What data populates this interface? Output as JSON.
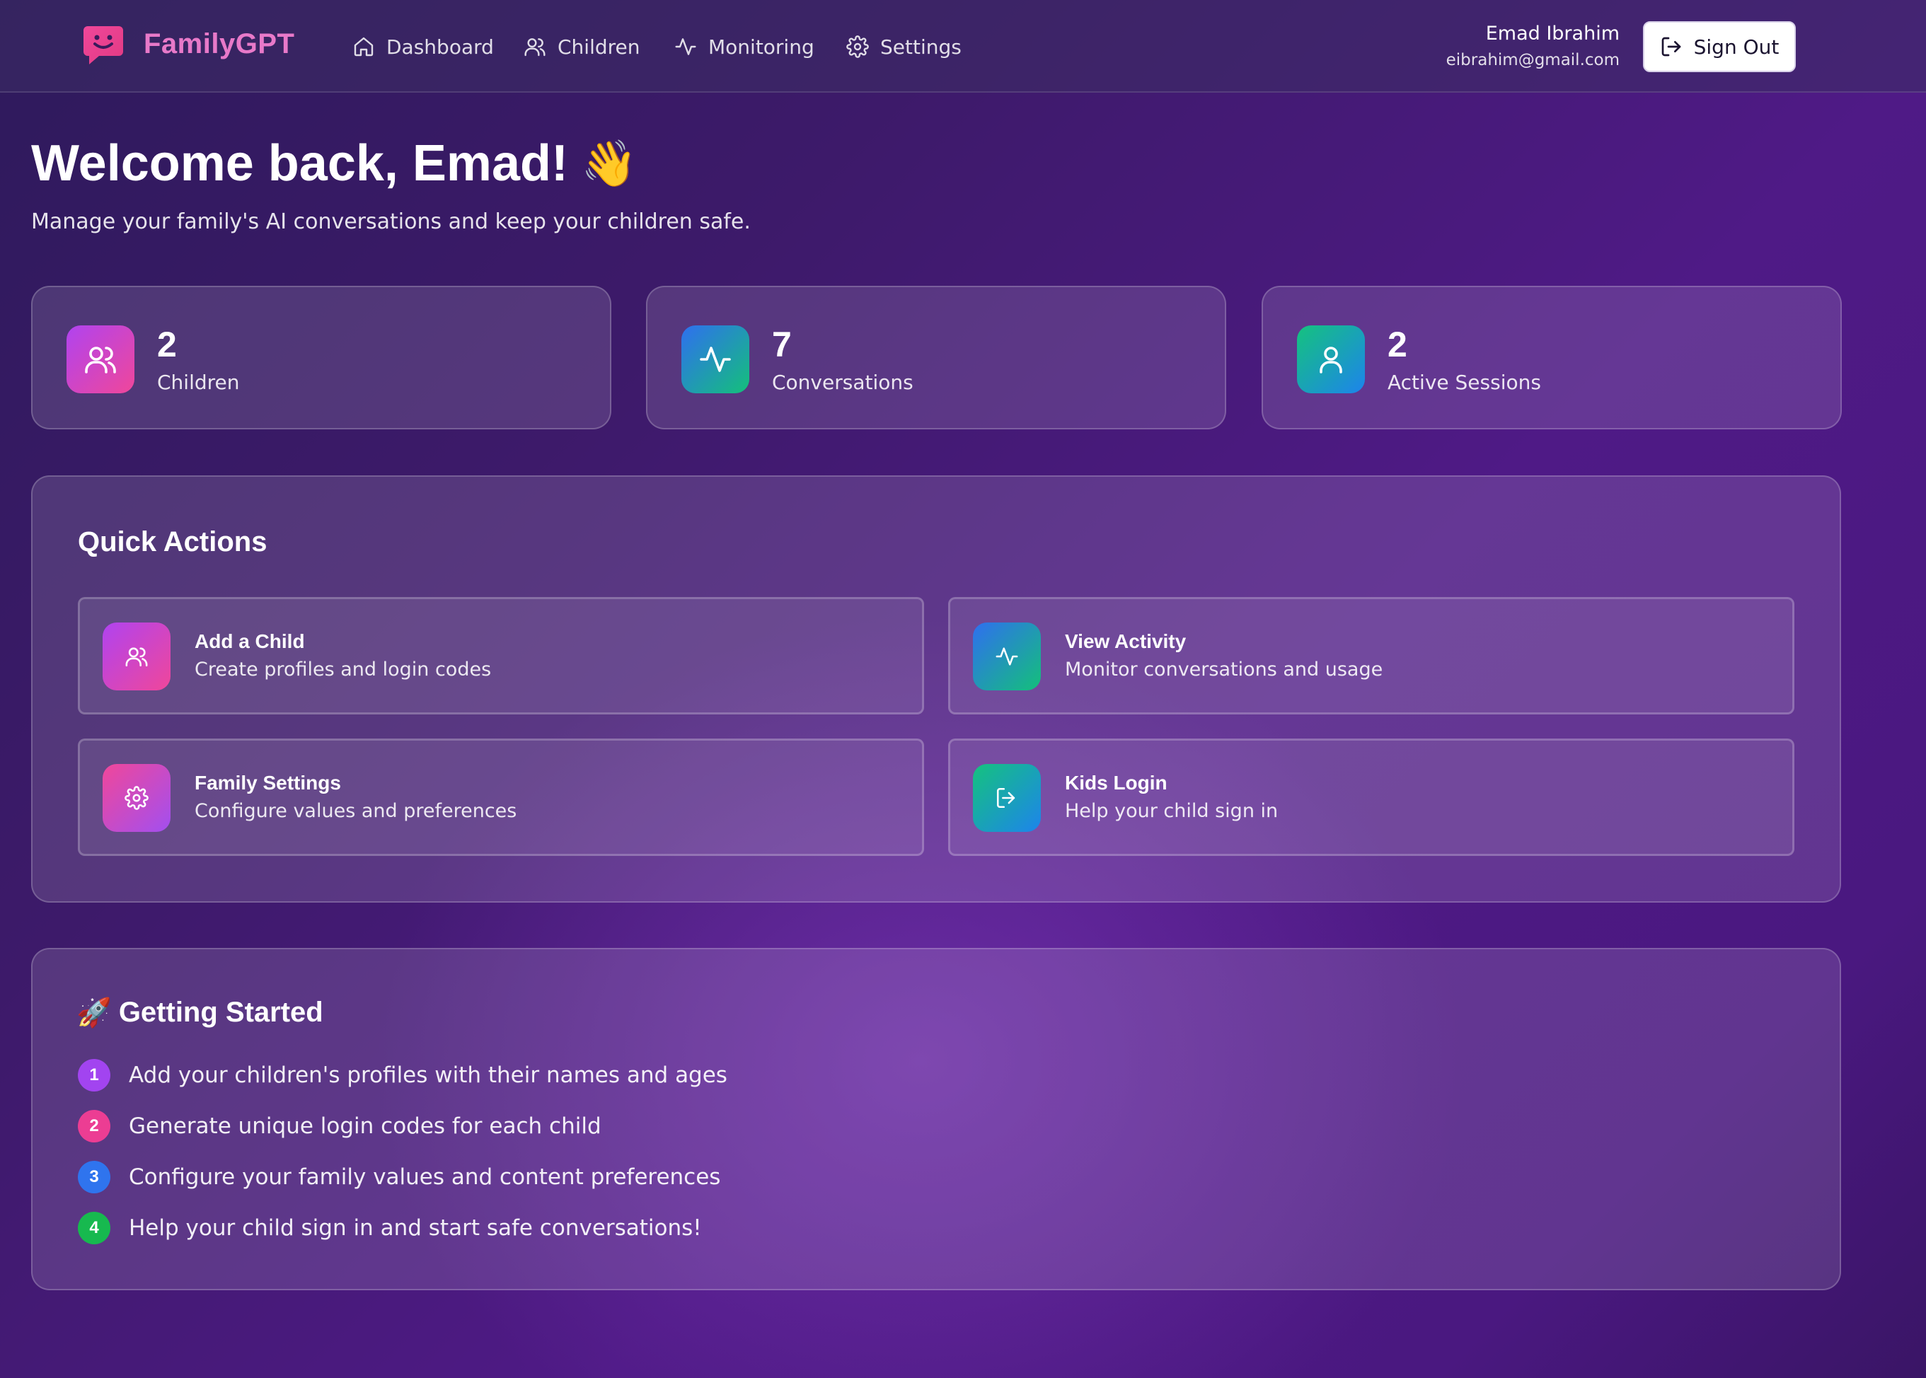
{
  "app": {
    "name": "FamilyGPT",
    "logo_icon": "chat-smile-icon",
    "brand_color": "#e879c9"
  },
  "nav": {
    "items": [
      {
        "label": "Dashboard",
        "icon": "home-icon"
      },
      {
        "label": "Children",
        "icon": "users-icon"
      },
      {
        "label": "Monitoring",
        "icon": "activity-icon"
      },
      {
        "label": "Settings",
        "icon": "gear-icon"
      }
    ]
  },
  "user": {
    "name": "Emad Ibrahim",
    "email": "eibrahim@gmail.com",
    "signout_label": "Sign Out"
  },
  "header": {
    "title": "Welcome back, Emad!",
    "emoji": "👋",
    "subtitle": "Manage your family's AI conversations and keep your children safe."
  },
  "stats": [
    {
      "value": "2",
      "label": "Children",
      "icon": "users-icon"
    },
    {
      "value": "7",
      "label": "Conversations",
      "icon": "activity-icon"
    },
    {
      "value": "2",
      "label": "Active Sessions",
      "icon": "user-icon"
    }
  ],
  "quick_actions": {
    "title": "Quick Actions",
    "items": [
      {
        "title": "Add a Child",
        "description": "Create profiles and login codes",
        "icon": "users-icon"
      },
      {
        "title": "View Activity",
        "description": "Monitor conversations and usage",
        "icon": "activity-icon"
      },
      {
        "title": "Family Settings",
        "description": "Configure values and preferences",
        "icon": "gear-icon"
      },
      {
        "title": "Kids Login",
        "description": "Help your child sign in",
        "icon": "login-icon"
      }
    ]
  },
  "getting_started": {
    "emoji": "🚀",
    "title": "Getting Started",
    "steps": [
      {
        "number": "1",
        "text": "Add your children's profiles with their names and ages",
        "color": "#a244f0"
      },
      {
        "number": "2",
        "text": "Generate unique login codes for each child",
        "color": "#ec3d93"
      },
      {
        "number": "3",
        "text": "Configure your family values and content preferences",
        "color": "#2f74ee"
      },
      {
        "number": "4",
        "text": "Help your child sign in and start safe conversations!",
        "color": "#17b94f"
      }
    ]
  }
}
